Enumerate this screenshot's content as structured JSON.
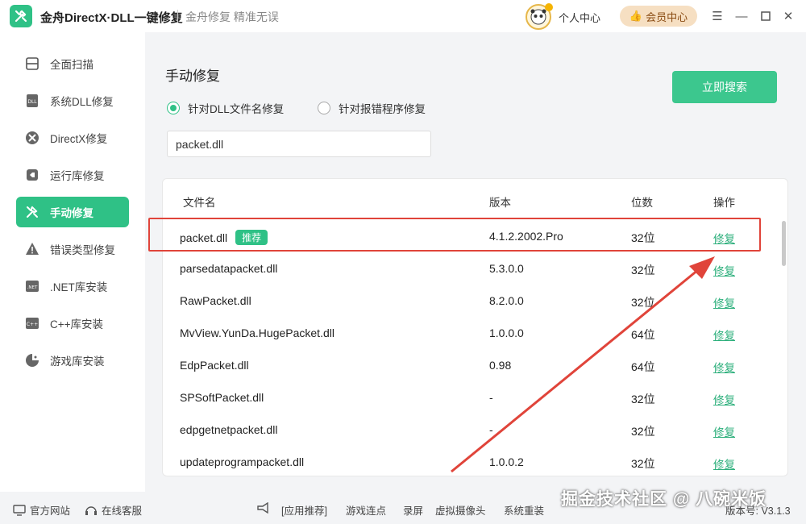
{
  "app": {
    "title": "金舟DirectX·DLL一键修复",
    "slogan": "金舟修复 精准无误",
    "user_center": "个人中心",
    "vip": "会员中心"
  },
  "sidebar": {
    "items": [
      {
        "label": "全面扫描",
        "icon": "scan-icon"
      },
      {
        "label": "系统DLL修复",
        "icon": "dll-icon"
      },
      {
        "label": "DirectX修复",
        "icon": "directx-icon"
      },
      {
        "label": "运行库修复",
        "icon": "vs-runtime-icon"
      },
      {
        "label": "手动修复",
        "icon": "tools-icon",
        "active": true
      },
      {
        "label": "错误类型修复",
        "icon": "warning-icon"
      },
      {
        "label": ".NET库安装",
        "icon": "dotnet-icon"
      },
      {
        "label": "C++库安装",
        "icon": "cpp-icon"
      },
      {
        "label": "游戏库安装",
        "icon": "game-icon"
      }
    ]
  },
  "main": {
    "title": "手动修复",
    "search_button": "立即搜索",
    "radio_dll": "针对DLL文件名修复",
    "radio_error": "针对报错程序修复",
    "query_value": "packet.dll",
    "columns": [
      "文件名",
      "版本",
      "位数",
      "操作"
    ],
    "recommend_badge": "推荐",
    "rows": [
      {
        "name": "packet.dll",
        "version": "4.1.2.2002.Pro",
        "bits": "32位",
        "action": "修复"
      },
      {
        "name": "parsedatapacket.dll",
        "version": "5.3.0.0",
        "bits": "32位",
        "action": "修复"
      },
      {
        "name": "RawPacket.dll",
        "version": "8.2.0.0",
        "bits": "32位",
        "action": "修复"
      },
      {
        "name": "MvView.YunDa.HugePacket.dll",
        "version": "1.0.0.0",
        "bits": "64位",
        "action": "修复"
      },
      {
        "name": "EdpPacket.dll",
        "version": "0.98",
        "bits": "64位",
        "action": "修复"
      },
      {
        "name": "SPSoftPacket.dll",
        "version": "-",
        "bits": "32位",
        "action": "修复"
      },
      {
        "name": "edpgetnetpacket.dll",
        "version": "-",
        "bits": "32位",
        "action": "修复"
      },
      {
        "name": "updateprogrampacket.dll",
        "version": "1.0.0.2",
        "bits": "32位",
        "action": "修复"
      }
    ]
  },
  "bottom": {
    "website": "官方网站",
    "support": "在线客服",
    "links": [
      "[应用推荐]",
      "游戏连点",
      "录屏",
      "虚拟摄像头",
      "系统重装"
    ],
    "version": "版本号: V3.1.3"
  },
  "watermark": "掘金技术社区 @ 八碗米饭",
  "colors": {
    "accent": "#2fc186",
    "highlight": "#e0443a",
    "vip_bg": "#f6dfc2"
  }
}
